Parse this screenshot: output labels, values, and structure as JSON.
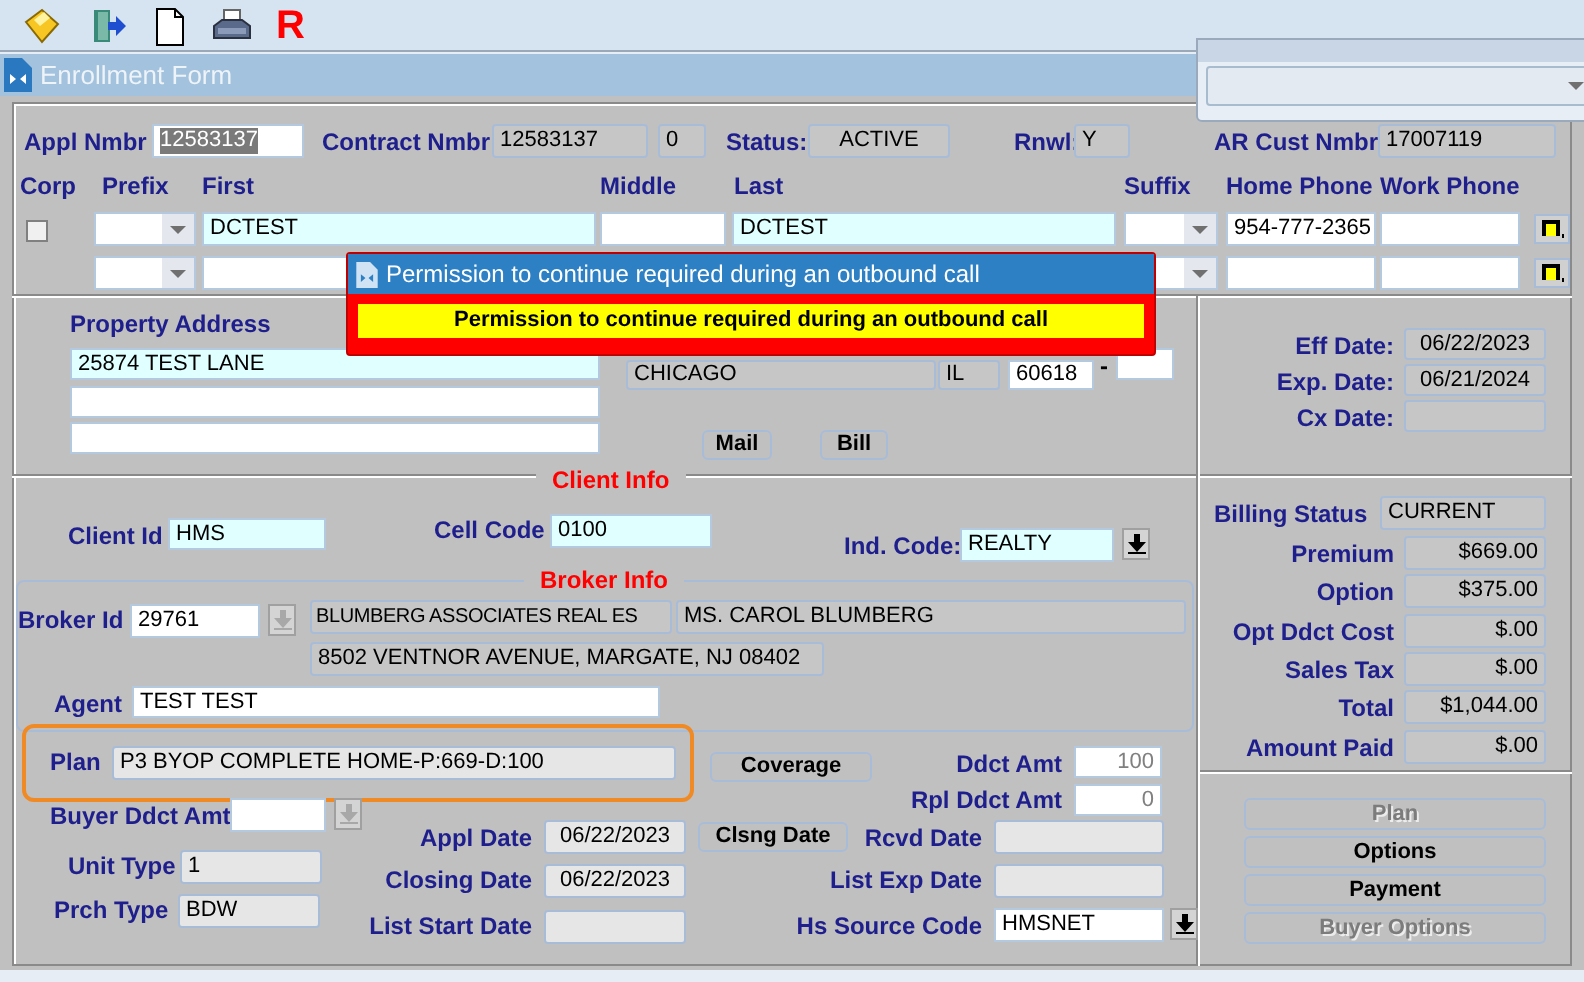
{
  "toolbar": {
    "letter_button": "R"
  },
  "window": {
    "title": "Enrollment Form"
  },
  "header": {
    "appl_nmbr": {
      "label": "Appl Nmbr",
      "value": "12583137",
      "highlighted": true
    },
    "contract_nmbr": {
      "label": "Contract Nmbr",
      "value": "12583137",
      "sequence": "0"
    },
    "status": {
      "label": "Status:",
      "value": "ACTIVE"
    },
    "rnwl": {
      "label": "Rnwl:",
      "value": "Y"
    },
    "ar_cust_nmbr": {
      "label": "AR Cust Nmbr",
      "value": "17007119"
    }
  },
  "name_grid": {
    "columns": [
      "Corp",
      "Prefix",
      "First",
      "Middle",
      "Last",
      "Suffix",
      "Home Phone",
      "Work Phone"
    ],
    "rows": [
      {
        "corp_checked": false,
        "first": "DCTEST",
        "last": "DCTEST",
        "home_phone": "954-777-2365"
      },
      {}
    ]
  },
  "dialog": {
    "title": "Permission to continue required during an outbound call",
    "message": "Permission to continue required during an outbound call"
  },
  "address": {
    "label": "Property Address",
    "lines": [
      "25874 TEST LANE"
    ],
    "city": "CHICAGO",
    "state": "IL",
    "zip": "60618",
    "zip_separator": "-",
    "buttons": [
      "Mail",
      "Bill"
    ]
  },
  "dates": [
    {
      "label": "Eff Date:",
      "value": "06/22/2023"
    },
    {
      "label": "Exp. Date:",
      "value": "06/21/2024"
    },
    {
      "label": "Cx Date:"
    }
  ],
  "client_info": {
    "heading": "Client Info",
    "client_id": {
      "label": "Client Id",
      "value": "HMS"
    },
    "cell_code": {
      "label": "Cell Code",
      "value": "0100"
    },
    "ind_code": {
      "label": "Ind. Code:",
      "value": "REALTY"
    }
  },
  "broker_info": {
    "heading": "Broker Info",
    "broker_id": {
      "label": "Broker Id",
      "value": "29761"
    },
    "broker_name": "BLUMBERG ASSOCIATES REAL ES",
    "contact": "MS. CAROL BLUMBERG",
    "address": "8502 VENTNOR AVENUE, MARGATE, NJ 08402",
    "agent": {
      "label": "Agent",
      "value": "TEST TEST"
    }
  },
  "plan": {
    "label": "Plan",
    "value": "P3 BYOP COMPLETE HOME-P:669-D:100",
    "highlighted": true
  },
  "coverage_button": "Coverage",
  "ddct_amt": {
    "label": "Ddct Amt",
    "value": "100"
  },
  "rpl_ddct_amt": {
    "label": "Rpl Ddct Amt",
    "value": "0"
  },
  "buyer_ddct_amt": {
    "label": "Buyer Ddct Amt"
  },
  "appl_date": {
    "label": "Appl Date",
    "value": "06/22/2023"
  },
  "clsng_date_button": "Clsng Date",
  "rcvd_date": {
    "label": "Rcvd Date"
  },
  "unit_type": {
    "label": "Unit Type",
    "value": "1"
  },
  "closing_date": {
    "label": "Closing Date",
    "value": "06/22/2023"
  },
  "list_exp_date": {
    "label": "List Exp Date"
  },
  "prch_type": {
    "label": "Prch Type",
    "value": "BDW"
  },
  "list_start_date": {
    "label": "List Start Date"
  },
  "hs_source_code": {
    "label": "Hs Source Code",
    "value": "HMSNET"
  },
  "billing": [
    {
      "label": "Billing Status",
      "value": "CURRENT"
    },
    {
      "label": "Premium",
      "value": "$669.00"
    },
    {
      "label": "Option",
      "value": "$375.00"
    },
    {
      "label": "Opt Ddct Cost",
      "value": "$.00"
    },
    {
      "label": "Sales Tax",
      "value": "$.00"
    },
    {
      "label": "Total",
      "value": "$1,044.00"
    },
    {
      "label": "Amount Paid",
      "value": "$.00"
    }
  ],
  "actions": [
    {
      "label": "Plan",
      "disabled": true
    },
    {
      "label": "Options",
      "disabled": false
    },
    {
      "label": "Payment",
      "disabled": false
    },
    {
      "label": "Buyer Options",
      "disabled": true
    }
  ]
}
